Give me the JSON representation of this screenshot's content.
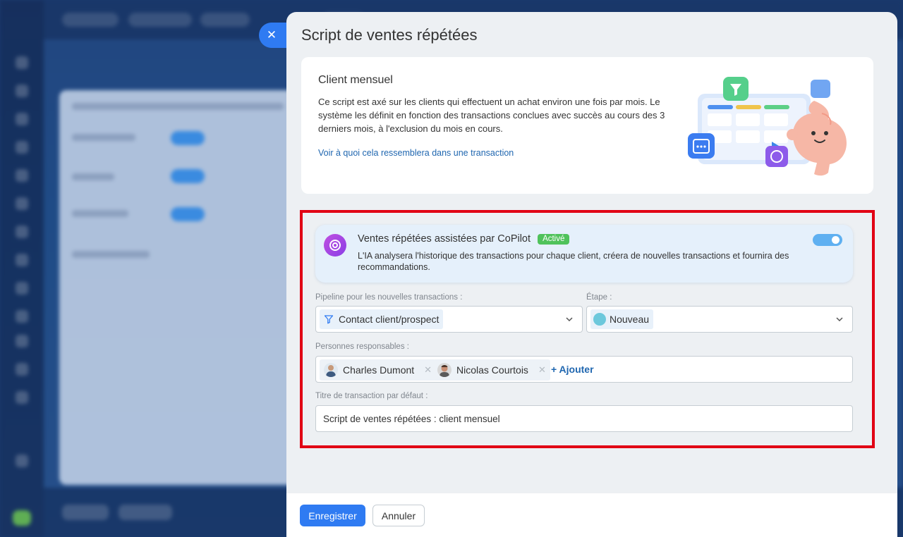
{
  "panel": {
    "title": "Script de ventes répétées"
  },
  "info": {
    "subtitle": "Client mensuel",
    "description": "Ce script est axé sur les clients qui effectuent un achat environ une fois par mois. Le système les définit en fonction des transactions conclues avec succès au cours des 3 derniers mois, à l'exclusion du mois en cours.",
    "link": "Voir à quoi cela ressemblera dans une transaction"
  },
  "copilot": {
    "title": "Ventes répétées assistées par CoPilot",
    "badge": "Activé",
    "description": "L'IA analysera l'historique des transactions pour chaque client, créera de nouvelles transactions et fournira des recommandations.",
    "enabled": true
  },
  "pipeline": {
    "label": "Pipeline pour les nouvelles transactions :",
    "value": "Contact client/prospect"
  },
  "stage": {
    "label": "Étape :",
    "value": "Nouveau",
    "color": "#6cc8dc"
  },
  "responsible": {
    "label": "Personnes responsables :",
    "people": [
      {
        "name": "Charles Dumont"
      },
      {
        "name": "Nicolas Courtois"
      }
    ],
    "add_label": "+ Ajouter"
  },
  "deal_title": {
    "label": "Titre de transaction par défaut :",
    "value": "Script de ventes répétées : client mensuel"
  },
  "footer": {
    "save_label": "Enregistrer",
    "cancel_label": "Annuler"
  },
  "colors": {
    "primary": "#2f7bf2",
    "highlight": "#e10014",
    "active_badge": "#4fc25b"
  }
}
